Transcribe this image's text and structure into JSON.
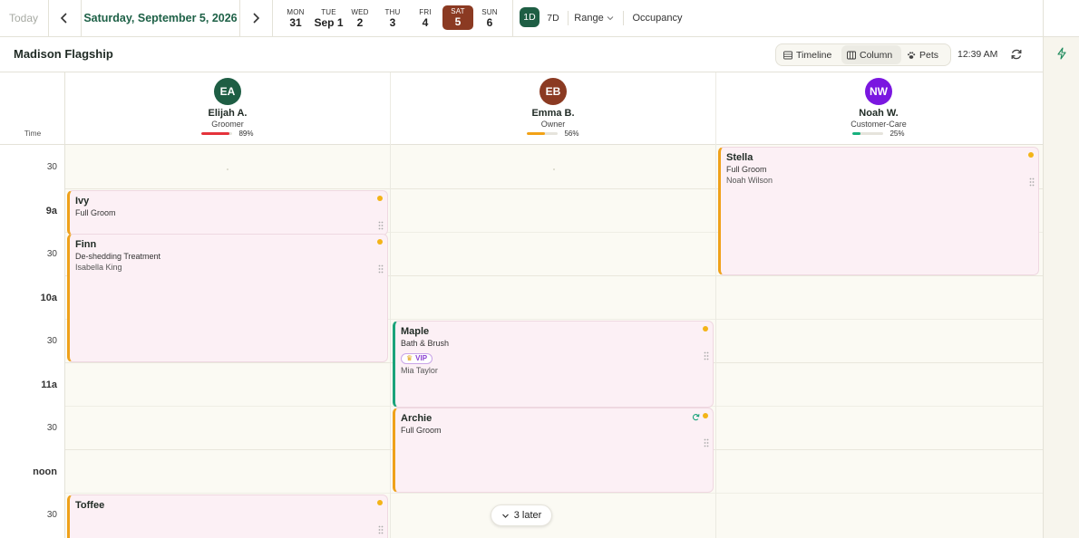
{
  "topbar": {
    "today_label": "Today",
    "prev_icon": "chevron-left-icon",
    "next_icon": "chevron-right-icon",
    "date_label": "Saturday, September 5, 2026",
    "days": [
      {
        "name": "MON",
        "num": "31",
        "active": false
      },
      {
        "name": "TUE",
        "num": "Sep 1",
        "active": false
      },
      {
        "name": "WED",
        "num": "2",
        "active": false
      },
      {
        "name": "THU",
        "num": "3",
        "active": false
      },
      {
        "name": "FRI",
        "num": "4",
        "active": false
      },
      {
        "name": "SAT",
        "num": "5",
        "active": true
      },
      {
        "name": "SUN",
        "num": "6",
        "active": false
      }
    ],
    "view_1d": "1D",
    "view_7d": "7D",
    "range_label": "Range",
    "occupancy_label": "Occupancy"
  },
  "subheader": {
    "location": "Madison Flagship",
    "views": {
      "timeline": "Timeline",
      "column": "Column",
      "pets": "Pets",
      "active": "Column"
    },
    "time": "12:39 AM"
  },
  "staff": [
    {
      "initials": "EA",
      "name": "Elijah A.",
      "role": "Groomer",
      "utilization_pct": "89%",
      "utilization": 89,
      "color": "#1e5e44",
      "bar_color": "#e5333b"
    },
    {
      "initials": "EB",
      "name": "Emma B.",
      "role": "Owner",
      "utilization_pct": "56%",
      "utilization": 56,
      "color": "#8b3a22",
      "bar_color": "#f2a216"
    },
    {
      "initials": "NW",
      "name": "Noah W.",
      "role": "Customer-Care",
      "utilization_pct": "25%",
      "utilization": 25,
      "color": "#7a17e0",
      "bar_color": "#17b07d"
    }
  ],
  "time_header": "Time",
  "time_labels": [
    "30",
    "9a",
    "30",
    "10a",
    "30",
    "11a",
    "30",
    "noon",
    "30"
  ],
  "appointments": {
    "ivy": {
      "pet": "Ivy",
      "service": "Full Groom"
    },
    "finn": {
      "pet": "Finn",
      "service": "De-shedding Treatment",
      "customer": "Isabella King"
    },
    "toffee": {
      "pet": "Toffee"
    },
    "maple": {
      "pet": "Maple",
      "service": "Bath & Brush",
      "badge": "VIP",
      "customer": "Mia Taylor"
    },
    "archie": {
      "pet": "Archie",
      "service": "Full Groom"
    },
    "stella": {
      "pet": "Stella",
      "service": "Full Groom",
      "customer": "Noah Wilson"
    }
  },
  "colors": {
    "accent": "#1e5e44",
    "active_day": "#8b3a22",
    "appt_bg": "#fcf0f5",
    "appt_border": "#efa11a",
    "status_dot": "#f3b418"
  },
  "later_label": "3 later"
}
